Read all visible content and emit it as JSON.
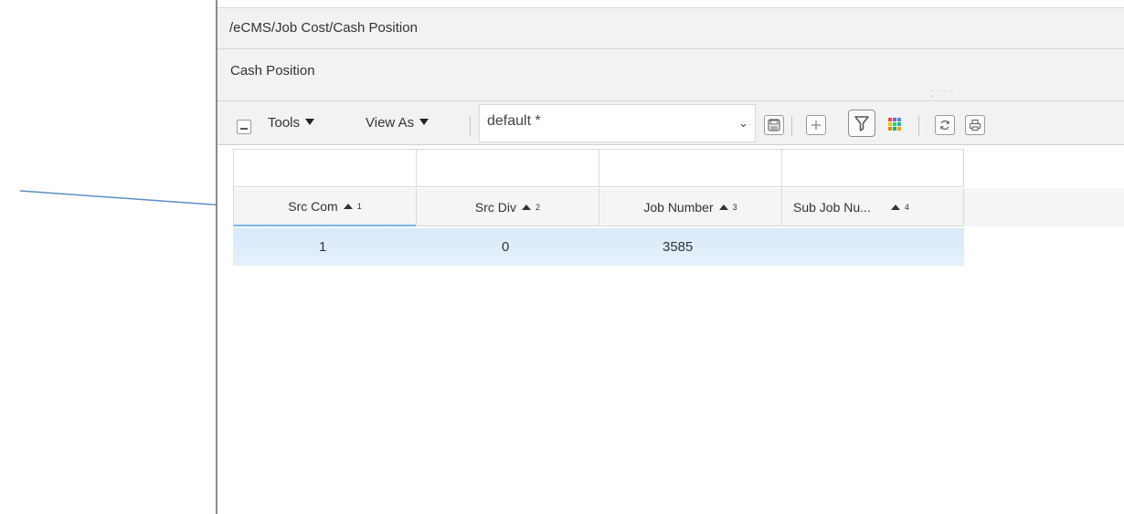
{
  "window": {
    "path": "/eCMS/Job Cost/Cash Position",
    "title": "Cash Position"
  },
  "toolbar": {
    "tools_label": "Tools",
    "view_as_label": "View As",
    "view_select_value": "default *",
    "icons": [
      "collapse-icon",
      "chevron-down-icon",
      "save-icon",
      "add-icon",
      "filter-icon",
      "color-grid-icon",
      "refresh-icon",
      "print-icon"
    ]
  },
  "grid": {
    "columns": [
      {
        "label": "Src Com",
        "sort_index": "1"
      },
      {
        "label": "Src Div",
        "sort_index": "2"
      },
      {
        "label": "Job Number",
        "sort_index": "3"
      },
      {
        "label": "Sub Job Nu...",
        "sort_index": "4"
      }
    ],
    "rows": [
      [
        "1",
        "0",
        "3585",
        ""
      ]
    ]
  },
  "colors": {
    "arrow": "#5b8fc7",
    "selected_row": "#d8e9fa",
    "active_header_underline": "#7fb2e5"
  }
}
